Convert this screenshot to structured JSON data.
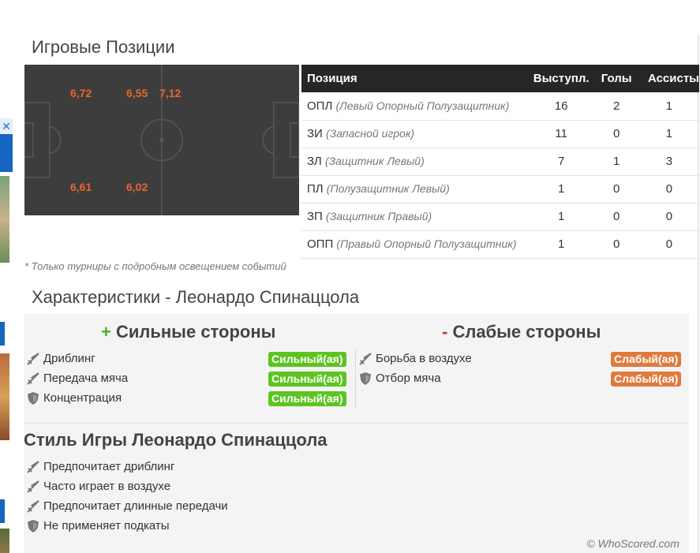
{
  "positions_section": {
    "title": "Игровые Позиции",
    "pitch_ratings": [
      "6,72",
      "6,55",
      "7,12",
      "6,61",
      "6,02"
    ],
    "table": {
      "headers": [
        "Позиция",
        "Выступл.",
        "Голы",
        "Ассисты"
      ],
      "rows": [
        {
          "code": "ОПЛ",
          "desc": "(Левый Опорный Полузащитник)",
          "apps": "16",
          "goals": "2",
          "assists": "1"
        },
        {
          "code": "ЗИ",
          "desc": "(Запасной игрок)",
          "apps": "11",
          "goals": "0",
          "assists": "1"
        },
        {
          "code": "ЗЛ",
          "desc": "(Защитник Левый)",
          "apps": "7",
          "goals": "1",
          "assists": "3"
        },
        {
          "code": "ПЛ",
          "desc": "(Полузащитник Левый)",
          "apps": "1",
          "goals": "0",
          "assists": "0"
        },
        {
          "code": "ЗП",
          "desc": "(Защитник Правый)",
          "apps": "1",
          "goals": "0",
          "assists": "0"
        },
        {
          "code": "ОПП",
          "desc": "(Правый Опорный Полузащитник)",
          "apps": "1",
          "goals": "0",
          "assists": "0"
        }
      ]
    },
    "note": "* Только турниры с подробным освещением событий"
  },
  "characteristics": {
    "title": "Характеристики - Леонардо Спинаццола",
    "strengths_sign": "+",
    "strengths_title": "Сильные стороны",
    "weaknesses_sign": "-",
    "weaknesses_title": "Слабые стороны",
    "strengths": [
      {
        "label": "Дриблинг",
        "level": "Сильный(ая)",
        "icon": "sword-icon"
      },
      {
        "label": "Передача мяча",
        "level": "Сильный(ая)",
        "icon": "sword-icon"
      },
      {
        "label": "Концентрация",
        "level": "Сильный(ая)",
        "icon": "shield-icon"
      }
    ],
    "weaknesses": [
      {
        "label": "Борьба в воздухе",
        "level": "Слабый(ая)",
        "icon": "sword-icon"
      },
      {
        "label": "Отбор мяча",
        "level": "Слабый(ая)",
        "icon": "shield-icon"
      }
    ],
    "colors": {
      "strong": "#5cc41f",
      "weak": "#e07a3c",
      "accent": "#e8662f"
    }
  },
  "play_style": {
    "title": "Стиль Игры Леонардо Спинаццола",
    "items": [
      {
        "label": "Предпочитает дриблинг",
        "icon": "sword-icon"
      },
      {
        "label": "Часто играет в воздухе",
        "icon": "sword-icon"
      },
      {
        "label": "Предпочитает длинные передачи",
        "icon": "sword-icon"
      },
      {
        "label": "Не применяет подкаты",
        "icon": "shield-icon"
      }
    ],
    "credit": "© WhoScored.com"
  },
  "ad": {
    "close_glyph": "✕"
  }
}
